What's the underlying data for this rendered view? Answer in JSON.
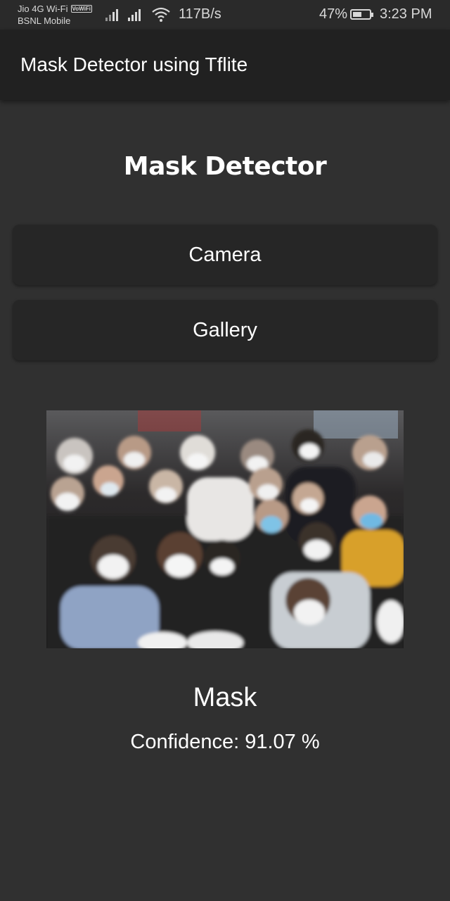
{
  "status_bar": {
    "carrier_1": "Jio 4G Wi-Fi",
    "vowifi_badge": "VoWiFi",
    "carrier_2": "BSNL Mobile",
    "net_speed": "117B/s",
    "battery_percent": "47%",
    "battery_level": 0.47,
    "time": "3:23 PM"
  },
  "app_bar": {
    "title": "Mask Detector using Tflite"
  },
  "main": {
    "heading": "Mask Detector",
    "camera_button": "Camera",
    "gallery_button": "Gallery",
    "result_label": "Mask",
    "confidence_text": "Confidence: 91.07 %"
  },
  "colors": {
    "background": "#303030",
    "app_bar": "#212121",
    "button": "#262626",
    "text": "#ffffff"
  },
  "icons": {
    "signal_1": "signal-icon",
    "signal_2": "signal-icon",
    "wifi": "wifi-icon",
    "battery": "battery-icon"
  }
}
